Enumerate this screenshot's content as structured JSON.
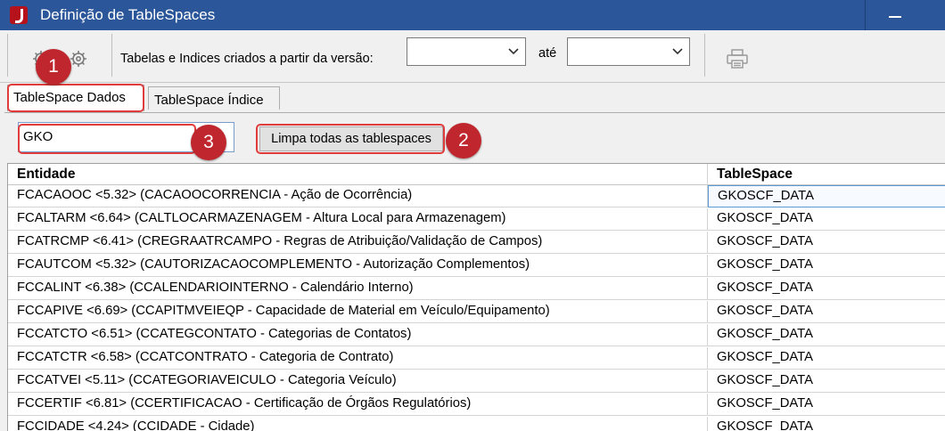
{
  "window": {
    "title": "Definição de TableSpaces"
  },
  "toolbar": {
    "version_label": "Tabelas e Indices criados a partir da versão:",
    "version_from": "",
    "ate_label": "até",
    "version_to": ""
  },
  "tabs": [
    {
      "label": "TableSpace Dados"
    },
    {
      "label": "TableSpace Índice"
    }
  ],
  "filter": {
    "value": "GKO"
  },
  "clear_button": {
    "label": "Limpa todas as tablespaces"
  },
  "grid": {
    "headers": {
      "entidade": "Entidade",
      "tablespace": "TableSpace"
    },
    "rows": [
      {
        "entidade": "FCACAOOC <5.32> (CACAOOCORRENCIA - Ação de Ocorrência)",
        "tablespace": "GKOSCF_DATA"
      },
      {
        "entidade": "FCALTARM <6.64> (CALTLOCARMAZENAGEM - Altura Local para Armazenagem)",
        "tablespace": "GKOSCF_DATA"
      },
      {
        "entidade": "FCATRCMP <6.41> (CREGRAATRCAMPO - Regras de Atribuição/Validação de Campos)",
        "tablespace": "GKOSCF_DATA"
      },
      {
        "entidade": "FCAUTCOM <5.32> (CAUTORIZACAOCOMPLEMENTO - Autorização Complementos)",
        "tablespace": "GKOSCF_DATA"
      },
      {
        "entidade": "FCCALINT <6.38> (CCALENDARIOINTERNO - Calendário Interno)",
        "tablespace": "GKOSCF_DATA"
      },
      {
        "entidade": "FCCAPIVE <6.69> (CCAPITMVEIEQP - Capacidade de Material em Veículo/Equipamento)",
        "tablespace": "GKOSCF_DATA"
      },
      {
        "entidade": "FCCATCTO <6.51> (CCATEGCONTATO - Categorias de Contatos)",
        "tablespace": "GKOSCF_DATA"
      },
      {
        "entidade": "FCCATCTR <6.58> (CCATCONTRATO - Categoria de Contrato)",
        "tablespace": "GKOSCF_DATA"
      },
      {
        "entidade": "FCCATVEI <5.11> (CCATEGORIAVEICULO - Categoria Veículo)",
        "tablespace": "GKOSCF_DATA"
      },
      {
        "entidade": "FCCERTIF <6.81> (CCERTIFICACAO - Certificação de Órgãos Regulatórios)",
        "tablespace": "GKOSCF_DATA"
      },
      {
        "entidade": "FCCIDADE <4.24> (CCIDADE - Cidade)",
        "tablespace": "GKOSCF_DATA"
      }
    ]
  },
  "annotations": [
    {
      "label": "1"
    },
    {
      "label": "2"
    },
    {
      "label": "3"
    }
  ],
  "colors": {
    "titlebar": "#2b579a",
    "badge": "#c0262d",
    "highlight": "#e03c3c",
    "selection": "#5b9bd5"
  }
}
